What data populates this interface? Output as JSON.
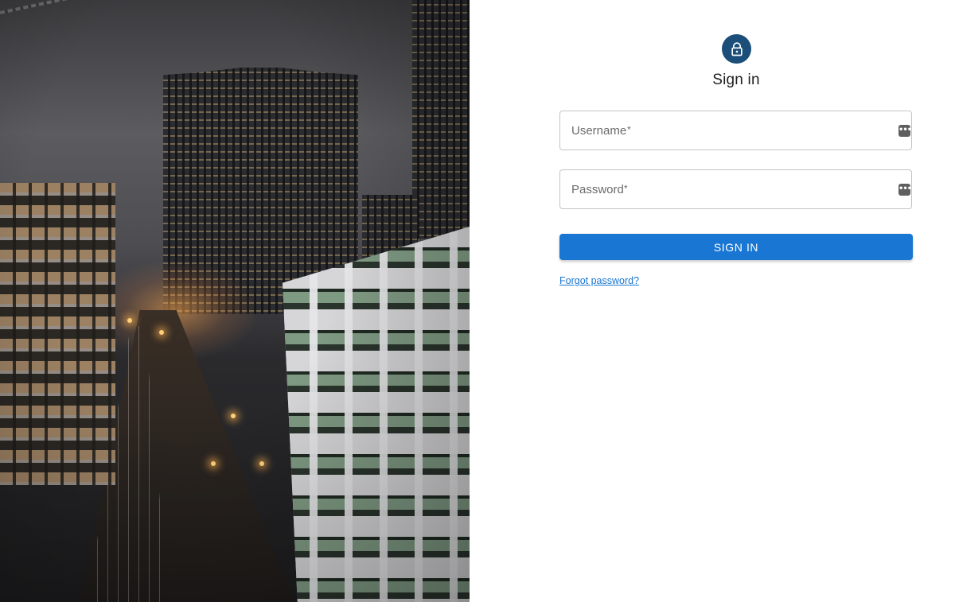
{
  "hero": {
    "image_description_icon": "city-night-photo"
  },
  "form": {
    "title": "Sign in",
    "avatar_icon": "lock-icon",
    "username": {
      "label": "Username",
      "required_marker": "*",
      "value": "",
      "icon": "password-manager-icon"
    },
    "password": {
      "label": "Password",
      "required_marker": "*",
      "value": "",
      "icon": "password-manager-icon"
    },
    "submit_label": "SIGN IN",
    "forgot_label": "Forgot password?"
  },
  "colors": {
    "accent": "#1976d2",
    "avatar_bg": "#1b4e78",
    "field_border": "#c4c4c4",
    "title_text": "#1f1f1f"
  }
}
